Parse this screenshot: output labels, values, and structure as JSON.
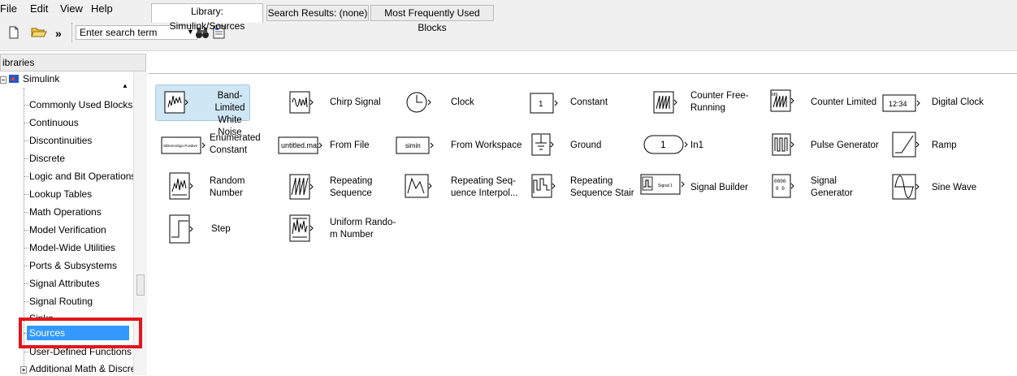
{
  "menu": {
    "file": "File",
    "edit": "Edit",
    "view": "View",
    "help": "Help"
  },
  "toolbar": {
    "more": "»",
    "search_placeholder": "Enter search term"
  },
  "libraries_header": "ibraries",
  "tree": {
    "root": "Simulink",
    "items": [
      "Commonly Used Blocks",
      "Continuous",
      "Discontinuities",
      "Discrete",
      "Logic and Bit Operations",
      "Lookup Tables",
      "Math Operations",
      "Model Verification",
      "Model-Wide Utilities",
      "Ports & Subsystems",
      "Signal Attributes",
      "Signal Routing",
      "Sinks",
      "Sources",
      "User-Defined Functions",
      "Additional Math & Discrete"
    ],
    "selected": "Sources"
  },
  "tabs": [
    "Library: Simulink/Sources",
    "Search Results: (none)",
    "Most Frequently Used Blocks"
  ],
  "blocks": [
    {
      "label": "Band-Limited\nWhite Noise",
      "icon": "band-limited-noise-icon"
    },
    {
      "label": "Chirp Signal",
      "icon": "chirp-icon"
    },
    {
      "label": "Clock",
      "icon": "clock-icon"
    },
    {
      "label": "Constant",
      "icon": "constant-icon",
      "icon_text": "1"
    },
    {
      "label": "Counter Free-\nRunning",
      "icon": "counter-free-icon"
    },
    {
      "label": "Counter Limited",
      "icon": "counter-limited-icon",
      "icon_text": "lim"
    },
    {
      "label": "Digital Clock",
      "icon": "digital-clock-icon",
      "icon_text": "12:34"
    },
    {
      "label": "Enumerated\nConstant",
      "icon": "enumerated-constant-icon",
      "icon_text": "SlDemoSign.Positive"
    },
    {
      "label": "From File",
      "icon": "from-file-icon",
      "icon_text": "untitled.mat"
    },
    {
      "label": "From Workspace",
      "icon": "from-workspace-icon",
      "icon_text": "simin"
    },
    {
      "label": "Ground",
      "icon": "ground-icon"
    },
    {
      "label": "In1",
      "icon": "inport-icon",
      "icon_text": "1"
    },
    {
      "label": "Pulse Generator",
      "icon": "pulse-icon"
    },
    {
      "label": "Ramp",
      "icon": "ramp-icon"
    },
    {
      "label": "Random\nNumber",
      "icon": "random-number-icon"
    },
    {
      "label": "Repeating\nSequence",
      "icon": "repeating-sequence-icon"
    },
    {
      "label": "Repeating Seq-\nuence Interpol...",
      "icon": "repeating-interp-icon"
    },
    {
      "label": "Repeating\nSequence Stair",
      "icon": "repeating-stair-icon"
    },
    {
      "label": "Signal Builder",
      "icon": "signal-builder-icon",
      "icon_text": "Signal 1"
    },
    {
      "label": "Signal\nGenerator",
      "icon": "signal-generator-icon",
      "icon_text": "0000"
    },
    {
      "label": "Sine Wave",
      "icon": "sine-wave-icon"
    },
    {
      "label": "Step",
      "icon": "step-icon"
    },
    {
      "label": "Uniform Rando-\nm Number",
      "icon": "uniform-random-icon"
    }
  ]
}
